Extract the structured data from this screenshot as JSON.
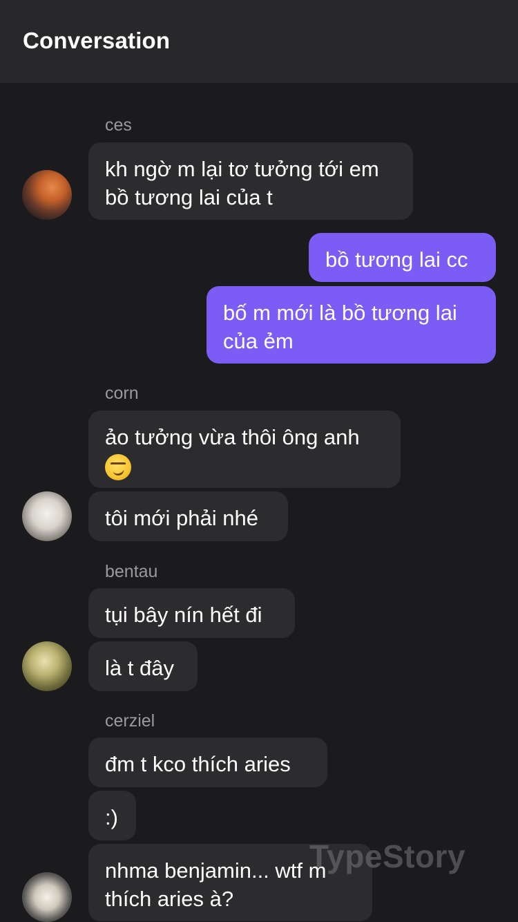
{
  "header": {
    "title": "Conversation"
  },
  "messages": {
    "group1": {
      "sender": "ces",
      "avatar_icon": "user-avatar-icon",
      "bubbles": [
        "kh ngờ m lại tơ tưởng tới em\nbồ tương lai của t"
      ]
    },
    "outgoing": {
      "bubbles": [
        "bồ tương lai cc",
        "bố m mới là bồ tương lai\ncủa ẻm"
      ]
    },
    "group2": {
      "sender": "corn",
      "avatar_icon": "user-avatar-icon",
      "bubbles": [
        "ảo tưởng vừa thôi ông anh",
        "tôi mới phải nhé"
      ],
      "emoji_icon": "smirking-face-emoji"
    },
    "group3": {
      "sender": "bentau",
      "avatar_icon": "user-avatar-icon",
      "bubbles": [
        "tụi bây nín hết đi",
        "là t đây"
      ]
    },
    "group4": {
      "sender": "cerziel",
      "avatar_icon": "user-avatar-icon",
      "bubbles": [
        "đm t kco thích aries",
        ":)",
        "nhma benjamin... wtf m\nthích aries à?"
      ]
    }
  },
  "watermark": "TypeStory",
  "colors": {
    "background": "#1b1b1d",
    "header": "#28282a",
    "incoming_bubble": "#2c2c2e",
    "outgoing_bubble": "#7b5cf5",
    "sender_text": "#9a9a9e"
  }
}
